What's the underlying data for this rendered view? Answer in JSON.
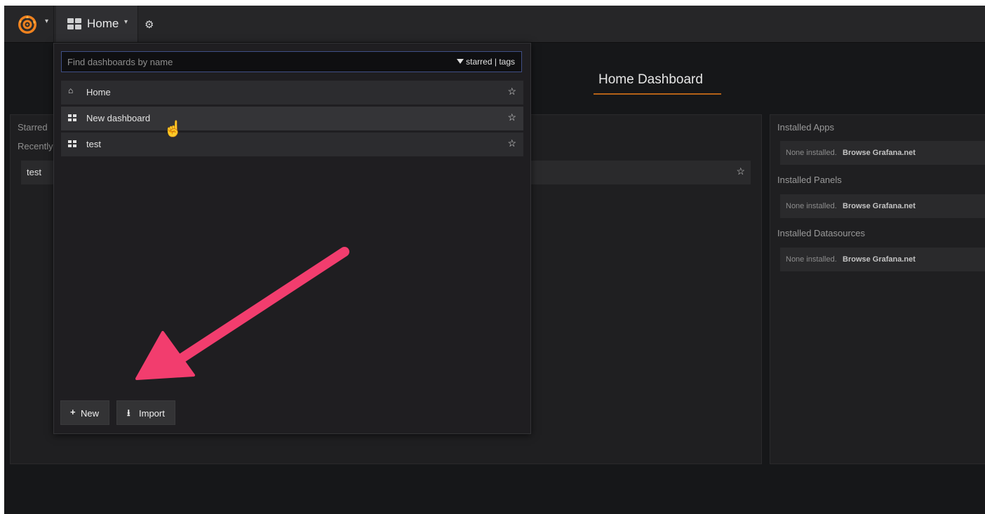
{
  "navbar": {
    "logo_icon": "grafana-logo-icon",
    "home_label": "Home",
    "settings_icon": "gear-icon"
  },
  "page": {
    "title": "Home Dashboard",
    "accent_color": "#eb7b18"
  },
  "left_panel": {
    "starred_label": "Starred",
    "recently_label": "Recently",
    "recent_item": "test"
  },
  "right_panel": {
    "sections": [
      {
        "title": "Installed Apps",
        "none_text": "None installed.",
        "browse_text": "Browse Grafana.net"
      },
      {
        "title": "Installed Panels",
        "none_text": "None installed.",
        "browse_text": "Browse Grafana.net"
      },
      {
        "title": "Installed Datasources",
        "none_text": "None installed.",
        "browse_text": "Browse Grafana.net"
      }
    ]
  },
  "dropdown": {
    "search_placeholder": "Find dashboards by name",
    "filter_starred": "starred",
    "filter_separator": "|",
    "filter_tags": "tags",
    "results": [
      {
        "label": "Home",
        "icon": "home-icon"
      },
      {
        "label": "New dashboard",
        "icon": "dashboard-grid-icon"
      },
      {
        "label": "test",
        "icon": "dashboard-grid-icon"
      }
    ],
    "new_label": "New",
    "import_label": "Import"
  },
  "annotation": {
    "arrow_color": "#f23d6e"
  }
}
